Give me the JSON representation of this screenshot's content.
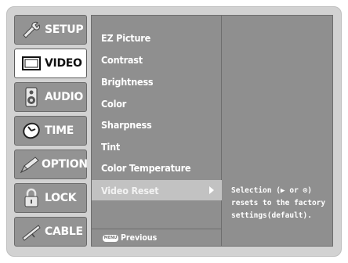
{
  "sidebar": {
    "items": [
      {
        "label": "SETUP",
        "icon": "setup-icon"
      },
      {
        "label": "VIDEO",
        "icon": "video-icon"
      },
      {
        "label": "AUDIO",
        "icon": "audio-icon"
      },
      {
        "label": "TIME",
        "icon": "time-icon"
      },
      {
        "label": "OPTION",
        "icon": "option-icon"
      },
      {
        "label": "LOCK",
        "icon": "lock-icon"
      },
      {
        "label": "CABLE",
        "icon": "cable-icon"
      }
    ],
    "active": "VIDEO"
  },
  "menu": {
    "items": [
      "EZ Picture",
      "Contrast",
      "Brightness",
      "Color",
      "Sharpness",
      "Tint",
      "Color Temperature",
      "Video Reset"
    ],
    "selected": "Video Reset",
    "menu_button_label": "MENU",
    "previous_label": "Previous"
  },
  "info": {
    "text": "Selection (▶ or ⊙)\nresets to the factory\nsettings(default)."
  },
  "colors": {
    "frame": "#d2d2d2",
    "panel": "#8f8f8f",
    "highlight": "#c2c2c2",
    "active_tab": "#ffffff"
  }
}
